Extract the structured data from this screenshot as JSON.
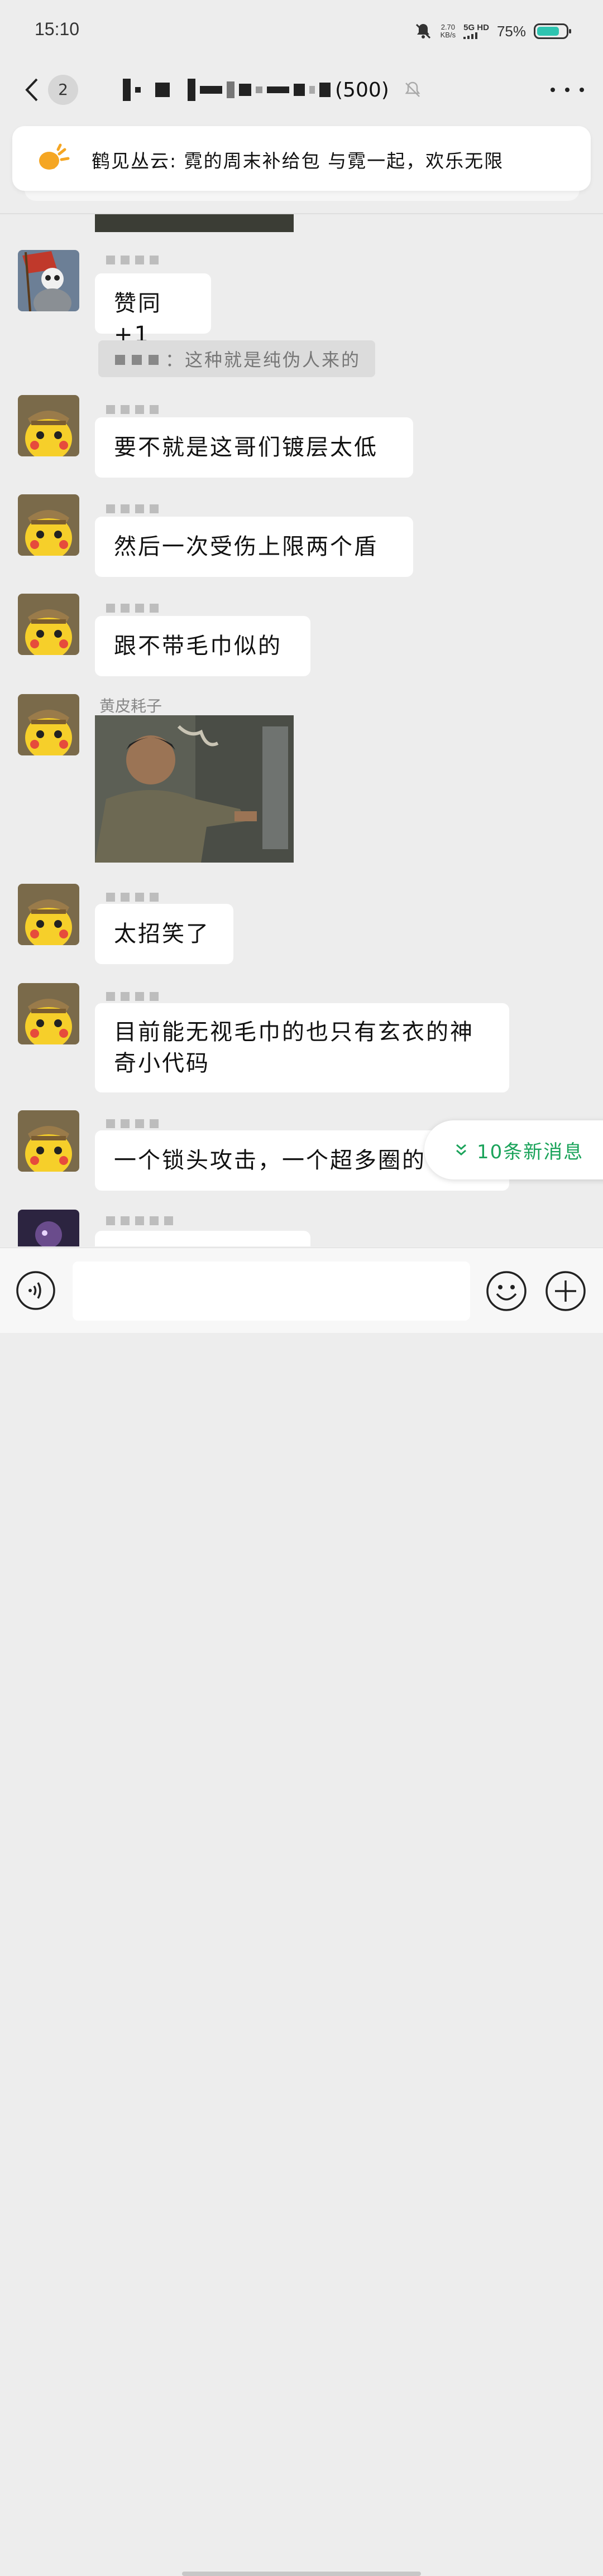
{
  "status_bar": {
    "time": "15:10",
    "net_speed": "2.70",
    "net_speed_unit": "KB/s",
    "network": "5G HD",
    "battery": "75%"
  },
  "header": {
    "back_icon": "chevron-left-icon",
    "unread_count": "2",
    "title_suffix": "(500)",
    "mute_icon": "bell-muted-icon",
    "more_icon": "more-dots-icon"
  },
  "notice": {
    "text": "鹤见丛云: 霓的周末补给包 与霓一起，欢乐无限"
  },
  "messages": {
    "m1": {
      "text": "赞同 +1"
    },
    "recall": {
      "text": "：这种就是纯伪人来的"
    },
    "m2": {
      "text": "要不就是这哥们镀层太低"
    },
    "m3": {
      "text": "然后一次受伤上限两个盾"
    },
    "m4": {
      "text": "跟不带毛巾似的"
    },
    "m5": {
      "sender": "黄皮耗子"
    },
    "m6": {
      "text": "太招笑了"
    },
    "m7": {
      "line1": "目前能无视毛巾的也只有玄衣的神",
      "line2": "奇小代码"
    },
    "m8": {
      "text": "一个锁头攻击，一个超多圈的"
    }
  },
  "new_messages_button": {
    "label": "10条新消息"
  },
  "input_bar": {
    "placeholder": ""
  },
  "colors": {
    "background": "#ededed",
    "bubble": "#ffffff",
    "accent_green": "#1aa35a"
  }
}
